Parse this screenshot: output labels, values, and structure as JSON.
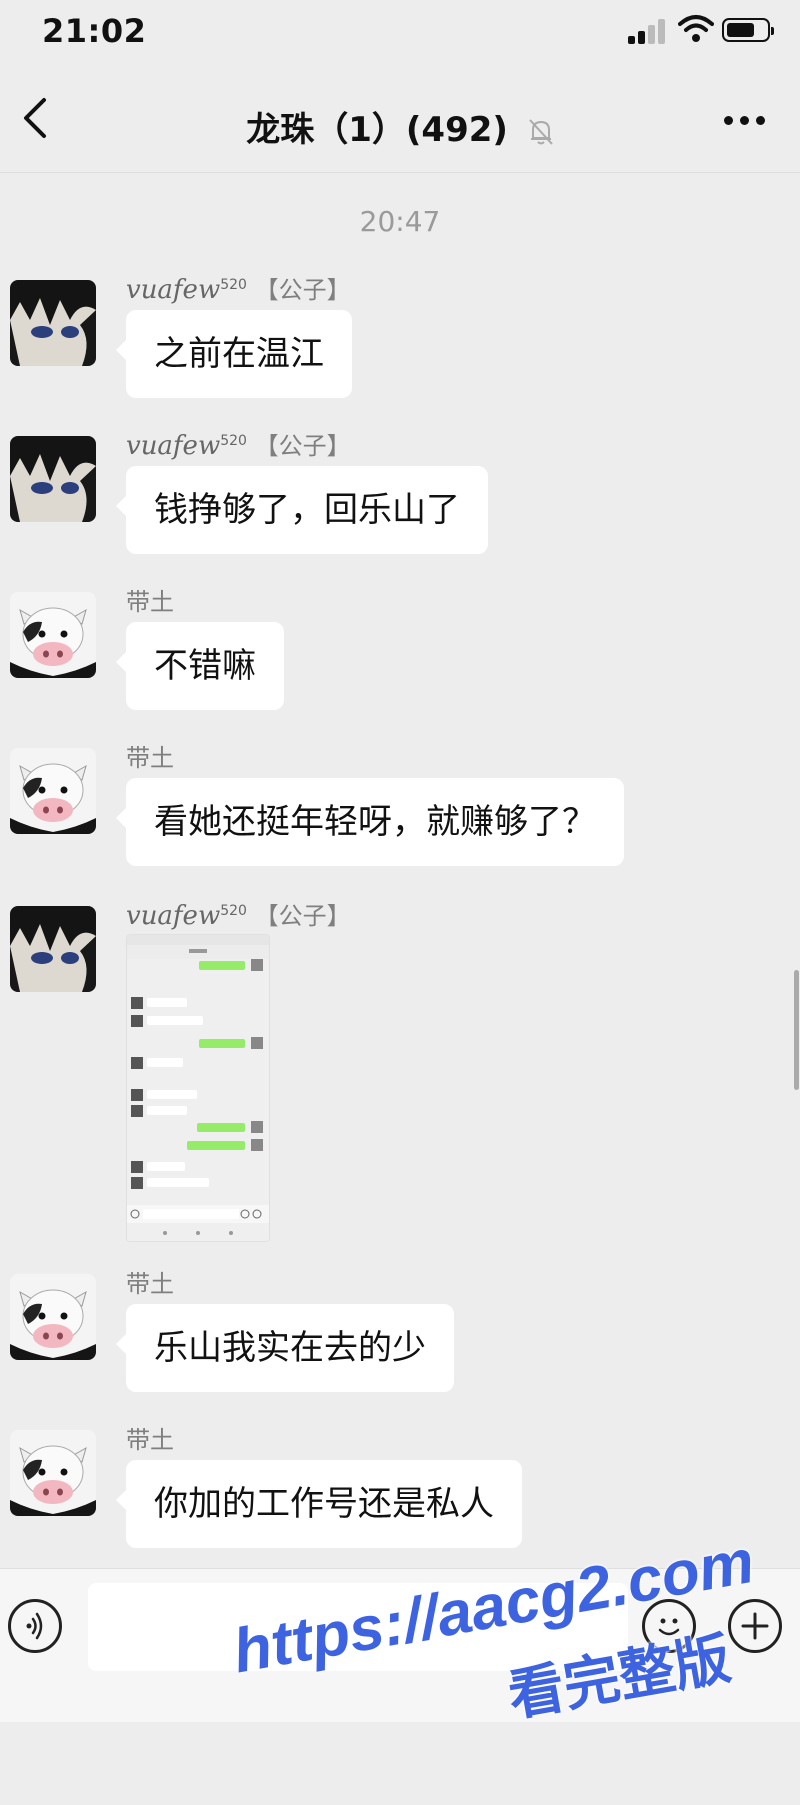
{
  "status_bar": {
    "time": "21:02"
  },
  "header": {
    "title": "龙珠（1）(492)"
  },
  "timestamp": "20:47",
  "messages": [
    {
      "sender": "vuafew",
      "sender_sup": "520",
      "sender_tag": "【公子】",
      "text": "之前在温江",
      "avatar": "anime-avatar"
    },
    {
      "sender": "vuafew",
      "sender_sup": "520",
      "sender_tag": "【公子】",
      "text": "钱挣够了，回乐山了",
      "avatar": "anime-avatar"
    },
    {
      "sender": "带土",
      "text": "不错嘛",
      "avatar": "cow-avatar"
    },
    {
      "sender": "带土",
      "text": "看她还挺年轻呀，就赚够了？",
      "avatar": "cow-avatar"
    },
    {
      "sender": "vuafew",
      "sender_sup": "520",
      "sender_tag": "【公子】",
      "type": "image",
      "avatar": "anime-avatar"
    },
    {
      "sender": "带土",
      "text": "乐山我实在去的少",
      "avatar": "cow-avatar"
    },
    {
      "sender": "带土",
      "text": "你加的工作号还是私人",
      "avatar": "cow-avatar"
    }
  ],
  "watermark": {
    "url": "https://aacg2.com",
    "text": "看完整版"
  },
  "icons": [
    "back-icon",
    "mute-icon",
    "more-icon",
    "voice-icon",
    "emoji-icon",
    "plus-icon"
  ]
}
